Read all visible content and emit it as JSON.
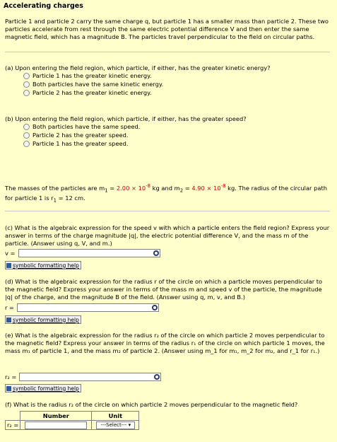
{
  "title": "Accelerating charges",
  "intro": "Particle 1 and particle 2 carry the same charge q, but particle 1 has a smaller mass than particle 2. These two particles accelerate from rest through the same electric potential difference V and then enter the same magnetic field, which has a magnitude B. The particles travel perpendicular to the field on circular paths.",
  "qa": {
    "prompt": "(a) Upon entering the field region, which particle, if either, has the greater kinetic energy?",
    "options": [
      "Particle 1 has the greater kinetic energy.",
      "Both particles have the same kinetic energy.",
      "Particle 2 has the greater kinetic energy."
    ]
  },
  "qb": {
    "prompt": "(b) Upon entering the field region, which particle, if either, has the greater speed?",
    "options": [
      "Both particles have the same speed.",
      "Particle 2 has the greater speed.",
      "Particle 1 has the greater speed."
    ]
  },
  "masses": {
    "text1": "The masses of the particles are m",
    "sub1": "1",
    "eq1": " = ",
    "m1": "2.00 × 10",
    "m1exp": "-8",
    "text2": " kg and m",
    "sub2": "2",
    "eq2": " = ",
    "m2": "4.90 × 10",
    "m2exp": "-8",
    "text3": " kg. The radius of the circular path for particle 1 is r",
    "sub3": "1",
    "text4": " = 12 cm."
  },
  "qc": {
    "prompt": "(c) What is the algebraic expression for the speed v with which a particle enters the field region? Express your answer in terms of the charge magnitude |q|, the electric potential difference V, and the mass m of the particle. (Answer using q, V, and m.)",
    "label": "v =",
    "value": ""
  },
  "qd": {
    "prompt": "(d) What is the algebraic expression for the radius r of the circle on which a particle moves perpendicular to the magnetic field? Express your answer in terms of the mass m and speed v of the particle, the magnitude |q| of the charge, and the magnitude B of the field. (Answer using q, m, v, and B.)",
    "label": "r =",
    "value": ""
  },
  "qe": {
    "prompt": "(e) What is the algebraic expression for the radius r₂ of the circle on which particle 2 moves perpendicular to the magnetic field? Express your answer in terms of the radius r₁ of the circle on which particle 1 moves, the mass m₁ of particle 1, and the mass m₂ of particle 2. (Answer using m_1 for m₁, m_2 for m₂, and r_1 for r₁.)",
    "label": "r₂ =",
    "value": ""
  },
  "symbolic_help": "symbolic formatting help",
  "qf": {
    "prompt": "(f) What is the radius r₂ of the circle on which particle 2 moves perpendicular to the magnetic field?",
    "col_number": "Number",
    "col_unit": "Unit",
    "row_label": "r₂ =",
    "unit_selected": "---Select---"
  },
  "colors": {
    "background": "#ffffcc",
    "highlight": "#cc0000"
  },
  "icons": [
    "radio-button",
    "preview-icon",
    "help-icon",
    "dropdown-arrow-icon"
  ]
}
